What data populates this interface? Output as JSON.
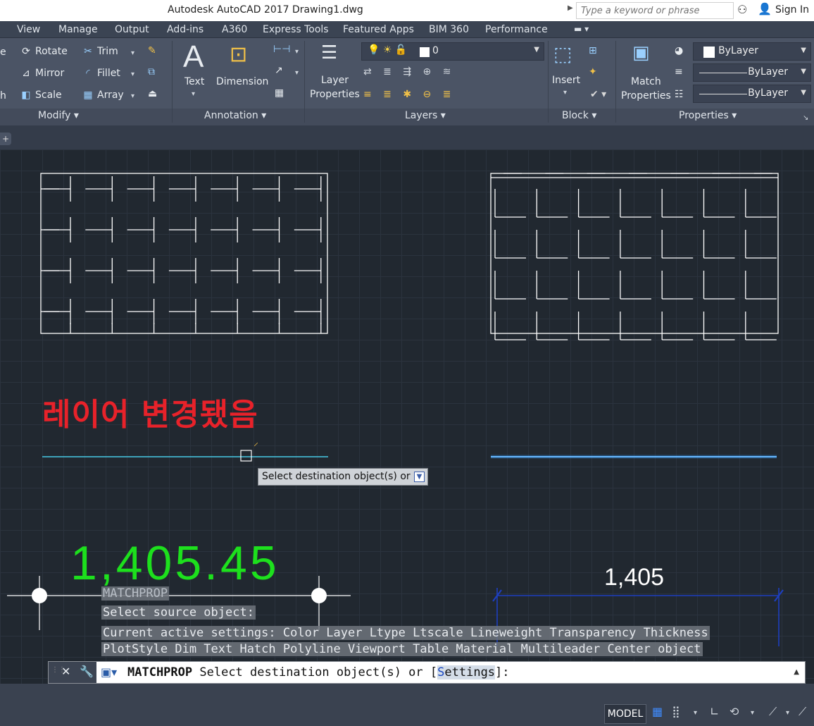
{
  "title_bar": {
    "title": "Autodesk AutoCAD 2017    Drawing1.dwg",
    "search_placeholder": "Type a keyword or phrase",
    "sign_in": "Sign In"
  },
  "menu": {
    "items": [
      "View",
      "Manage",
      "Output",
      "Add-ins",
      "A360",
      "Express Tools",
      "Featured Apps",
      "BIM 360",
      "Performance"
    ]
  },
  "ribbon": {
    "modify": {
      "title": "Modify",
      "tools": [
        "Rotate",
        "Trim",
        "Mirror",
        "Fillet",
        "Scale",
        "Array"
      ],
      "partial_left": [
        "e",
        "h"
      ]
    },
    "annotation": {
      "title": "Annotation",
      "text": "Text",
      "dimension": "Dimension"
    },
    "layers": {
      "title": "Layers",
      "properties_line1": "Layer",
      "properties_line2": "Properties",
      "current_layer": "0"
    },
    "block": {
      "title": "Block",
      "insert": "Insert"
    },
    "properties": {
      "title": "Properties",
      "match_line1": "Match",
      "match_line2": "Properties",
      "color": "ByLayer",
      "linetype": "ByLayer",
      "lineweight": "ByLayer"
    }
  },
  "canvas": {
    "korean_note": "레이어 변경됐음",
    "big_number": "1,405.45",
    "dim_value": "1,405",
    "tooltip": "Select destination object(s) or"
  },
  "history": [
    "MATCHPROP",
    "Select source object:",
    "Current active settings:  Color Layer Ltype Ltscale Lineweight Transparency Thickness",
    "PlotStyle Dim Text Hatch Polyline Viewport Table Material Multileader Center object"
  ],
  "command": {
    "name": "MATCHPROP",
    "prompt": "Select destination object(s) or [",
    "option_key": "S",
    "option_rest": "ettings",
    "suffix": "]:"
  },
  "status": {
    "model": "MODEL"
  },
  "colors": {
    "korean_note": "#e8222a",
    "big_number": "#1de01d",
    "cyan_line": "#49c9e6",
    "blue_line": "#2f8de8",
    "dim_blue": "#1e3fbf"
  }
}
